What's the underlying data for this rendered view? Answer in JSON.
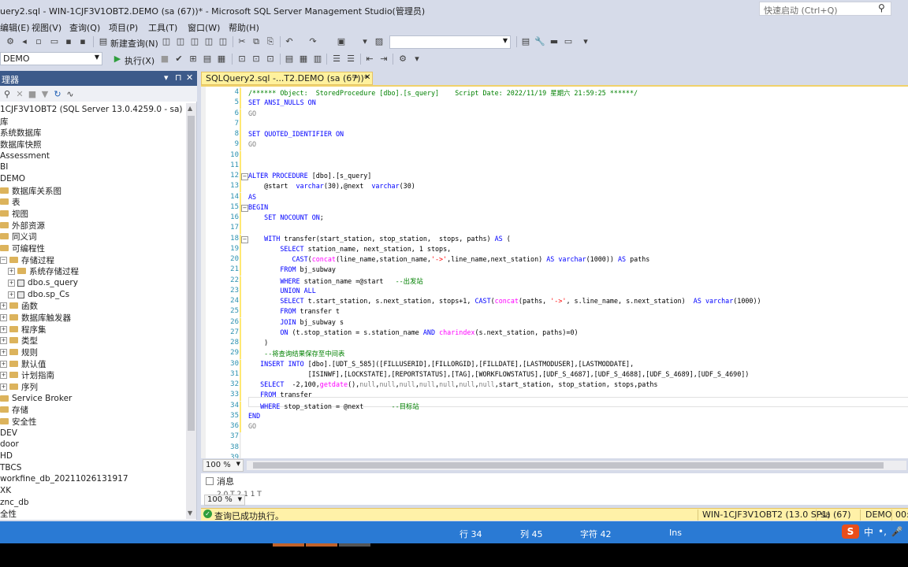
{
  "window": {
    "title": "uery2.sql - WIN-1CJF3V1OBT2.DEMO (sa (67))* - Microsoft SQL Server Management Studio(管理员)"
  },
  "quick_launch": {
    "placeholder": "快速启动 (Ctrl+Q)",
    "icon": "search-icon"
  },
  "menu": [
    "编辑(E)",
    "视图(V)",
    "查询(Q)",
    "项目(P)",
    "工具(T)",
    "窗口(W)",
    "帮助(H)"
  ],
  "toolbar1": {
    "new_query_label": "新建查询(N)"
  },
  "toolbar2": {
    "database_value": "DEMO",
    "execute_label": "执行(X)"
  },
  "object_explorer": {
    "title": "理器",
    "controls": [
      "▾",
      "⊓",
      "✕"
    ],
    "server": "1CJF3V1OBT2 (SQL Server 13.0.4259.0 - sa)",
    "nodes": [
      "库",
      "系统数据库",
      "数据库快照",
      "Assessment",
      "BI",
      "DEMO",
      "数据库关系图",
      "表",
      "视图",
      "外部资源",
      "同义词",
      "可编程性",
      "存储过程",
      "系统存储过程",
      "dbo.s_query",
      "dbo.sp_Cs",
      "函数",
      "数据库触发器",
      "程序集",
      "类型",
      "规则",
      "默认值",
      "计划指南",
      "序列",
      "Service Broker",
      "存储",
      "安全性",
      "DEV",
      "door",
      "HD",
      "TBCS",
      "workfine_db_20211026131917",
      "XK",
      "znc_db",
      "全性"
    ]
  },
  "editor": {
    "tab_label": "SQLQuery2.sql -...T2.DEMO (sa (67))*",
    "line_numbers": [
      "4",
      "5",
      "6",
      "7",
      "8",
      "9",
      "10",
      "11",
      "12",
      "13",
      "14",
      "15",
      "16",
      "17",
      "18",
      "19",
      "20",
      "21",
      "22",
      "23",
      "24",
      "25",
      "26",
      "27",
      "28",
      "29",
      "30",
      "31",
      "32",
      "33",
      "34",
      "35",
      "36",
      "37",
      "38",
      "39"
    ],
    "lines": [
      "/****** Object:  StoredProcedure [dbo].[s_query]    Script Date: 2022/11/19 星期六 21:59:25 ******/",
      "SET ANSI_NULLS ON",
      "GO",
      "",
      "SET QUOTED_IDENTIFIER ON",
      "GO",
      "",
      "",
      "ALTER PROCEDURE [dbo].[s_query]",
      "    @start  varchar(30),@next  varchar(30)",
      "AS",
      "BEGIN",
      "    SET NOCOUNT ON;",
      "",
      "    WITH transfer(start_station, stop_station,  stops, paths) AS (",
      "        SELECT station_name, next_station, 1 stops,",
      "           CAST(concat(line_name,station_name,'->',line_name,next_station) AS varchar(1000)) AS paths",
      "        FROM bj_subway",
      "        WHERE station_name =@start   --出发站",
      "        UNION ALL",
      "        SELECT t.start_station, s.next_station, stops+1, CAST(concat(paths, '->', s.line_name, s.next_station)  AS varchar(1000))",
      "        FROM transfer t",
      "        JOIN bj_subway s",
      "        ON (t.stop_station = s.station_name AND charindex(s.next_station, paths)=0)",
      "    )",
      "    --将查询结果保存至中间表",
      "   INSERT INTO [dbo].[UDT_S_585]([FILLUSERID],[FILLORGID],[FILLDATE],[LASTMODUSER],[LASTMODDATE],",
      "               [ISINWF],[LOCKSTATE],[REPORTSTATUS],[TAG],[WORKFLOWSTATUS],[UDF_S_4687],[UDF_S_4688],[UDF_S_4689],[UDF_S_4690])",
      "   SELECT  -2,100,getdate(),null,null,null,null,null,null,null,start_station, stop_station, stops,paths",
      "   FROM transfer",
      "   WHERE stop_station = @next       --目标站",
      "END",
      "GO",
      "",
      "",
      ""
    ],
    "zoom": "100 %"
  },
  "results": {
    "messages_tab": "消息",
    "zoom": "100 %",
    "line_fragment": "2 0 T 2 1 1 T"
  },
  "query_status": {
    "message": "查询已成功执行。",
    "server": "WIN-1CJF3V1OBT2 (13.0 SP1)",
    "user": "sa (67)",
    "database": "DEMO",
    "time": "00:00"
  },
  "status_bar": {
    "row": "行 34",
    "col": "列 45",
    "char": "字符 42",
    "mode": "Ins"
  },
  "ime": {
    "logo": "S",
    "lang": "中",
    "punct": "•,",
    "mic": "mic-icon"
  },
  "colors": {
    "accent": "#2a7ad4",
    "tab": "#fff19d",
    "oe_header": "#3c5a8a"
  }
}
